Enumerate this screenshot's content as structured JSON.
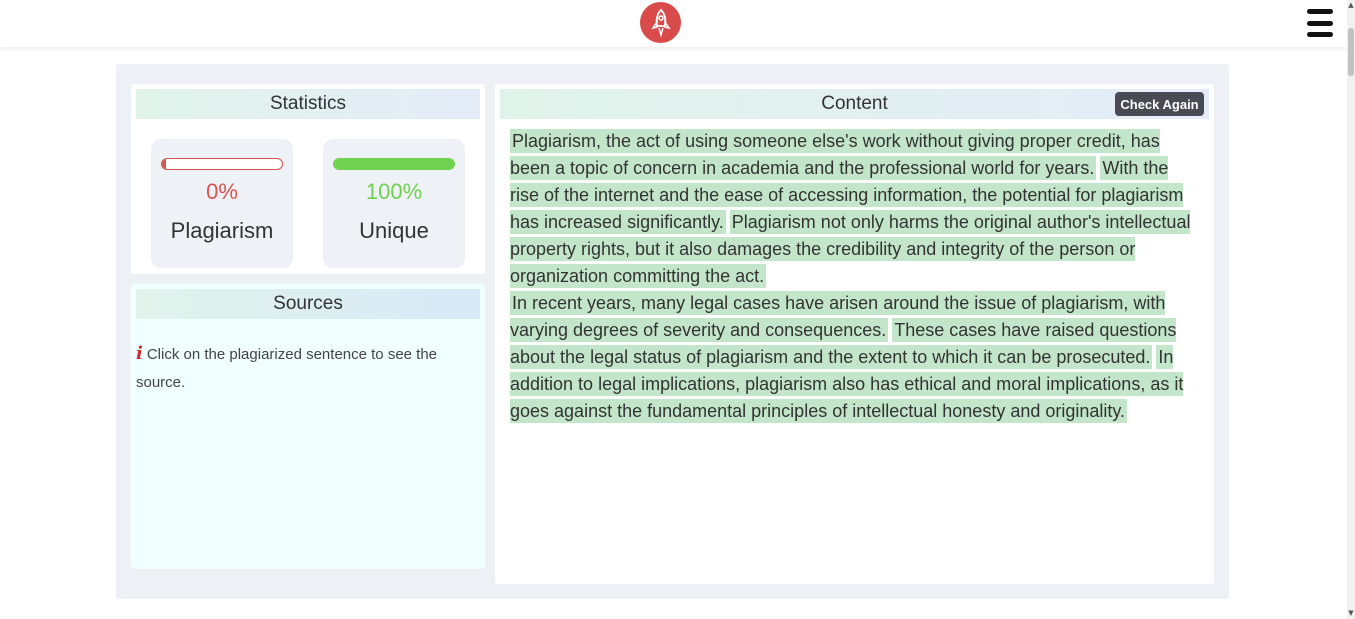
{
  "header": {
    "logo_icon": "rocket-icon",
    "menu_icon": "hamburger-menu-icon",
    "brand_color": "#d94b4b"
  },
  "statistics": {
    "title": "Statistics",
    "plagiarism": {
      "percent_text": "0%",
      "label": "Plagiarism",
      "fraction": 0.0,
      "color": "#d9534f"
    },
    "unique": {
      "percent_text": "100%",
      "label": "Unique",
      "fraction": 1.0,
      "color": "#6fd14f"
    }
  },
  "sources": {
    "title": "Sources",
    "info_icon": "info-icon",
    "info_text": "Click on the plagiarized sentence to see the source."
  },
  "content": {
    "title": "Content",
    "check_again_label": "Check Again",
    "highlight_color": "#c3e6cb",
    "paragraphs": [
      [
        "Plagiarism, the act of using someone else's work without giving proper credit, has been a topic of concern in academia and the professional world for years.",
        "With the rise of the internet and the ease of accessing information, the potential for plagiarism has increased significantly.",
        "Plagiarism not only harms the original author's intellectual property rights, but it also damages the credibility and integrity of the person or organization committing the act."
      ],
      [
        "In recent years, many legal cases have arisen around the issue of plagiarism, with varying degrees of severity and consequences.",
        "These cases have raised questions about the legal status of plagiarism and the extent to which it can be prosecuted.",
        "In addition to legal implications, plagiarism also has ethical and moral implications, as it goes against the fundamental principles of intellectual honesty and originality."
      ]
    ]
  }
}
